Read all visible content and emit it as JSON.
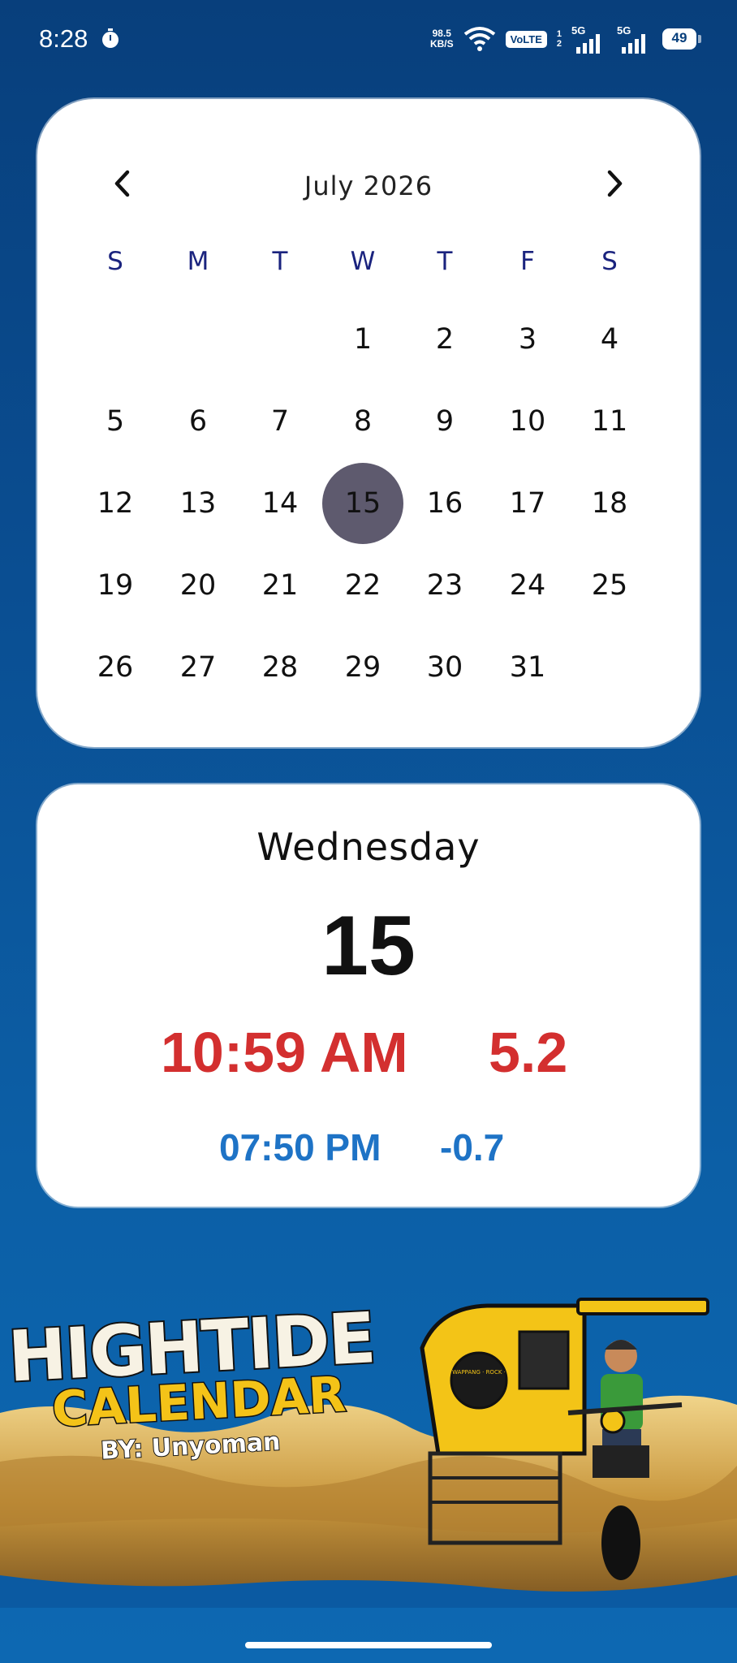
{
  "status_bar": {
    "time": "8:28",
    "net_speed_value": "98.5",
    "net_speed_unit": "KB/S",
    "volte": "VoLTE",
    "sim_top": "1",
    "sim_bottom": "2",
    "signal1_label": "5G",
    "signal2_label": "5G",
    "battery": "49",
    "icons": [
      "timer-icon",
      "wifi-icon",
      "signal-icon",
      "battery-icon"
    ]
  },
  "calendar": {
    "month_title": "July 2026",
    "weekdays": [
      "S",
      "M",
      "T",
      "W",
      "T",
      "F",
      "S"
    ],
    "first_weekday_index": 3,
    "days": [
      "1",
      "2",
      "3",
      "4",
      "5",
      "6",
      "7",
      "8",
      "9",
      "10",
      "11",
      "12",
      "13",
      "14",
      "15",
      "16",
      "17",
      "18",
      "19",
      "20",
      "21",
      "22",
      "23",
      "24",
      "25",
      "26",
      "27",
      "28",
      "29",
      "30",
      "31"
    ],
    "selected_day": "15",
    "colors": {
      "weekday": "#1a237e",
      "selected": "#5e5a6e"
    }
  },
  "day_detail": {
    "weekday": "Wednesday",
    "day": "15",
    "high_tide_time": "10:59 AM",
    "high_tide_height": "5.2",
    "low_tide_time": "07:50 PM",
    "low_tide_height": "-0.7",
    "colors": {
      "high": "#d32f2f",
      "low": "#1e73c6"
    }
  },
  "banner": {
    "line1": "HIGHTIDE",
    "line2": "CALENDAR",
    "line3": "BY: Unyoman",
    "sidecar_text": "WAPPANG · ROCK ·"
  }
}
